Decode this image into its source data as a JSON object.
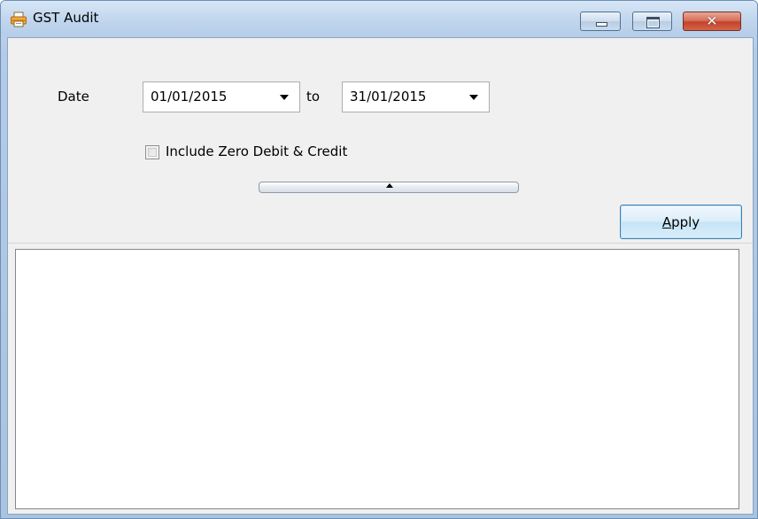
{
  "window": {
    "title": "GST Audit",
    "close_glyph": "✕"
  },
  "filters": {
    "date_label": "Date",
    "date_from": "01/01/2015",
    "to_label": "to",
    "date_to": "31/01/2015",
    "include_zero": {
      "label": "Include Zero Debit & Credit",
      "checked": false
    }
  },
  "actions": {
    "apply_prefix": "",
    "apply_mnemonic": "A",
    "apply_rest": "pply"
  },
  "icons": {
    "title": "printer-icon",
    "minimize": "minimize-icon",
    "maximize": "maximize-icon",
    "close": "close-icon",
    "date_dropdown": "chevron-down-icon",
    "collapse": "chevron-up-icon"
  },
  "colors": {
    "titlebar": "#c2d7ee",
    "close_button": "#c2432c",
    "apply_border": "#3c7fb1"
  }
}
